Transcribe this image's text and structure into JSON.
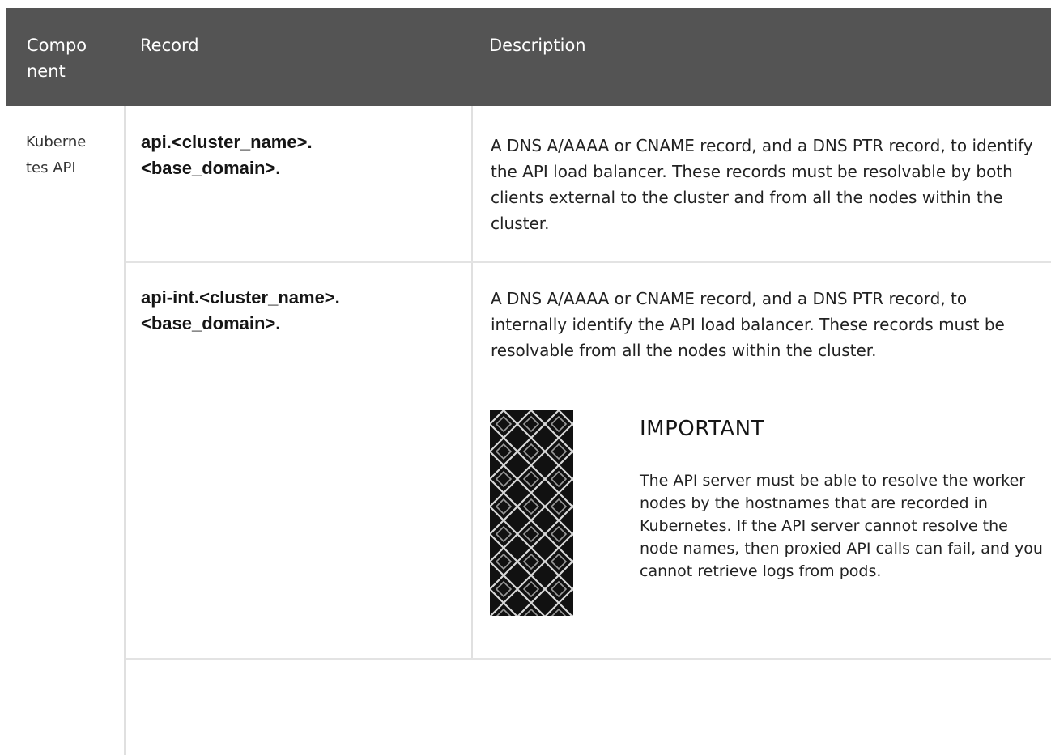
{
  "table": {
    "headers": {
      "component": "Compo nent",
      "record": "Record",
      "description": "Description"
    },
    "component": "Kuberne tes API",
    "rows": [
      {
        "record": "api.<cluster_name>. <base_domain>.",
        "description": "A DNS A/AAAA or CNAME record, and a DNS PTR record, to identify the API load balancer. These records must be resolvable by both clients external to the cluster and from all the nodes within the cluster."
      },
      {
        "record": "api-int.<cluster_name>. <base_domain>.",
        "description": "A DNS A/AAAA or CNAME record, and a DNS PTR record, to internally identify the API load balancer. These records must be resolvable from all the nodes within the cluster.",
        "admonition": {
          "icon": "important-pattern-icon",
          "title": "IMPORTANT",
          "body": "The API server must be able to resolve the worker nodes by the hostnames that are recorded in Kubernetes. If the API server cannot resolve the node names, then proxied API calls can fail, and you cannot retrieve logs from pods."
        }
      },
      {
        "record": "",
        "description": ""
      }
    ]
  }
}
